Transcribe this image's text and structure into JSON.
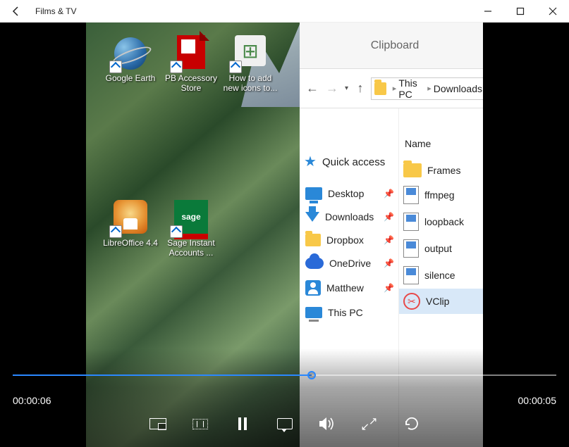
{
  "app": {
    "title": "Films & TV"
  },
  "desktop_icons": [
    {
      "label": "Google Earth"
    },
    {
      "label": "PB Accessory Store"
    },
    {
      "label": "How to add new icons to..."
    },
    {
      "label": "LibreOffice 4.4"
    },
    {
      "label": "Sage Instant Accounts ..."
    }
  ],
  "explorer": {
    "ribbon_label": "Clipboard",
    "breadcrumb": {
      "root": "This PC",
      "folder": "Downloads"
    },
    "quick_access": {
      "header": "Quick access",
      "items": [
        {
          "label": "Desktop"
        },
        {
          "label": "Downloads"
        },
        {
          "label": "Dropbox"
        },
        {
          "label": "OneDrive"
        },
        {
          "label": "Matthew"
        },
        {
          "label": "This PC"
        }
      ]
    },
    "file_list": {
      "column": "Name",
      "items": [
        {
          "label": "Frames"
        },
        {
          "label": "ffmpeg"
        },
        {
          "label": "loopback"
        },
        {
          "label": "output"
        },
        {
          "label": "silence"
        },
        {
          "label": "VClip"
        }
      ]
    }
  },
  "player": {
    "elapsed": "00:00:06",
    "remaining": "00:00:05",
    "progress_pct": 55
  }
}
